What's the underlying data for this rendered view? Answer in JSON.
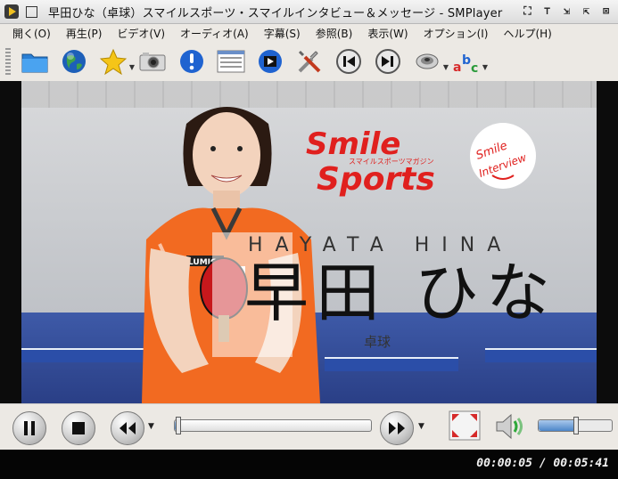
{
  "window": {
    "title": "早田ひな（卓球）スマイルスポーツ・スマイルインタビュー＆メッセージ - SMPlayer"
  },
  "menu": {
    "items": [
      {
        "label": "開く(O)"
      },
      {
        "label": "再生(P)"
      },
      {
        "label": "ビデオ(V)"
      },
      {
        "label": "オーディオ(A)"
      },
      {
        "label": "字幕(S)"
      },
      {
        "label": "参照(B)"
      },
      {
        "label": "表示(W)"
      },
      {
        "label": "オプション(I)"
      },
      {
        "label": "ヘルプ(H)"
      }
    ]
  },
  "toolbar": {
    "buttons": [
      {
        "icon": "folder-icon"
      },
      {
        "icon": "globe-icon"
      },
      {
        "icon": "star-icon",
        "has_dropdown": true
      },
      {
        "icon": "camera-icon"
      },
      {
        "icon": "info-icon"
      },
      {
        "icon": "playlist-icon"
      },
      {
        "icon": "film-icon"
      },
      {
        "icon": "tools-icon"
      },
      {
        "icon": "previous-icon"
      },
      {
        "icon": "next-icon"
      },
      {
        "icon": "audio-track-icon",
        "has_dropdown": true
      },
      {
        "icon": "subtitle-abc-icon",
        "has_dropdown": true
      }
    ]
  },
  "video": {
    "caption": {
      "romaji": "HAYATA  HINA",
      "name": "早田 ひな",
      "sport": "卓球"
    },
    "logo": {
      "line1": "Smile",
      "line2": "Sports",
      "tagline": "スマイルスポーツマガジン"
    },
    "badge": {
      "line1": "Smile",
      "line2": "Interview"
    },
    "shirt_text": "LUMICA"
  },
  "controls": {
    "seek_fraction": 0.015,
    "volume_fraction": 0.5
  },
  "status": {
    "time_display": "00:00:05 / 00:05:41"
  },
  "colors": {
    "accent_red": "#e0201e",
    "shirt_orange": "#f26a21",
    "seek_blue": "#4c86c8"
  }
}
